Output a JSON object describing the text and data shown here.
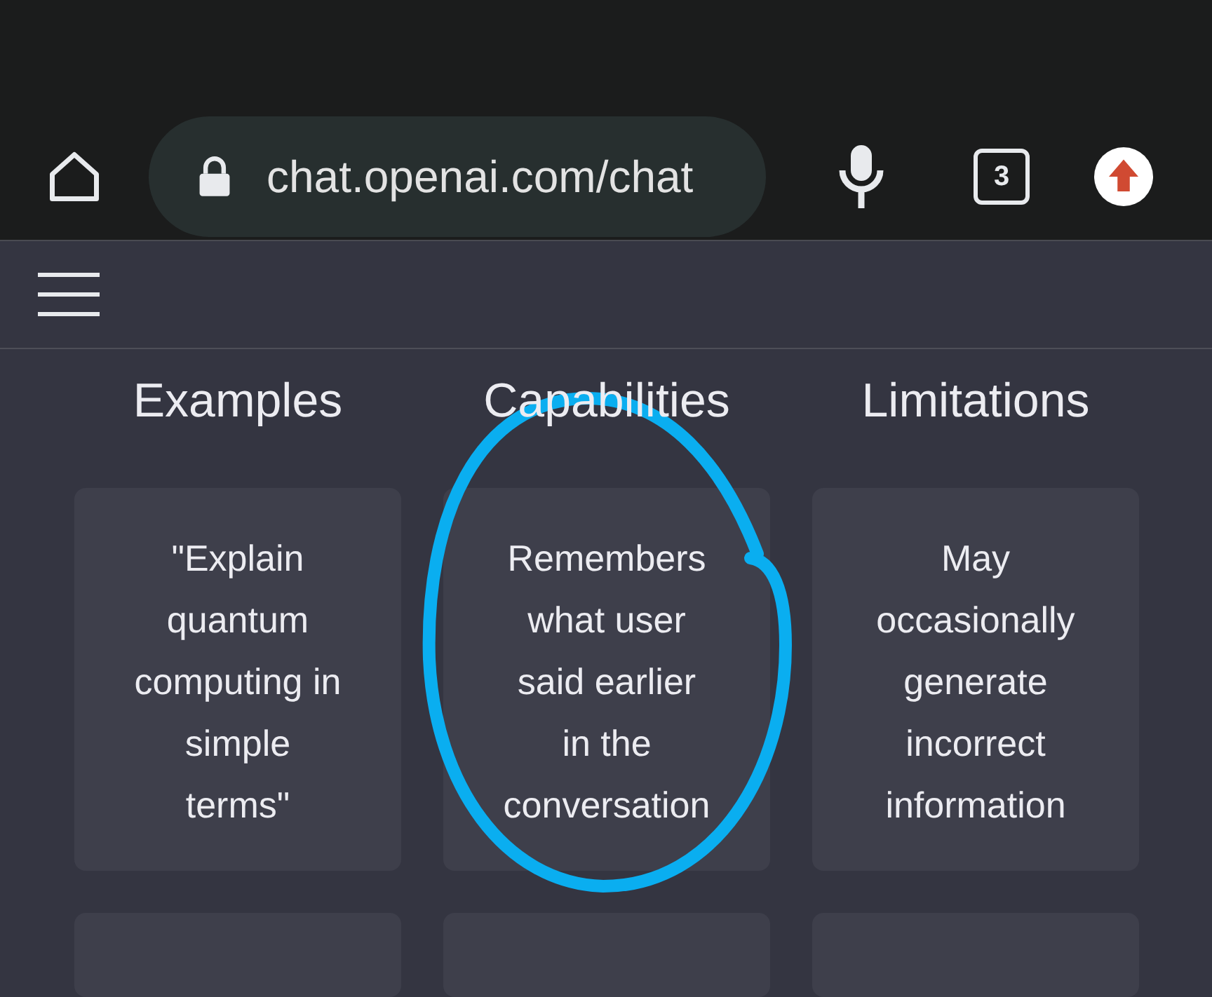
{
  "browser": {
    "url": "chat.openai.com/chat",
    "tab_count": "3"
  },
  "columns": [
    {
      "heading": "Examples",
      "cards": [
        {
          "kind": "text",
          "text": "\"Explain quantum computing in simple terms\""
        },
        {
          "kind": "cut-off"
        }
      ]
    },
    {
      "heading": "Capabilities",
      "cards": [
        {
          "kind": "text",
          "text": "Remembers what user said earlier in the conversation"
        },
        {
          "kind": "cut-off"
        }
      ]
    },
    {
      "heading": "Limitations",
      "cards": [
        {
          "kind": "text",
          "text": "May occasionally generate incorrect information"
        },
        {
          "kind": "cut-off"
        }
      ]
    }
  ],
  "annotation": {
    "kind": "circle",
    "color": "#0aaef0"
  }
}
